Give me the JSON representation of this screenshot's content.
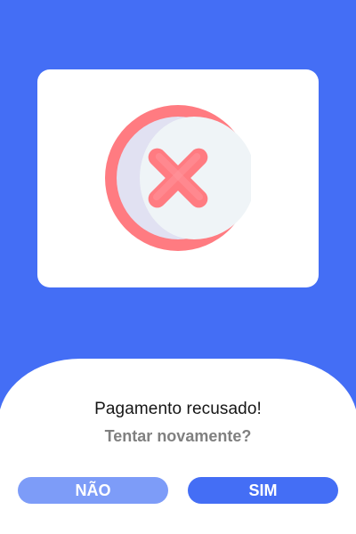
{
  "dialog": {
    "title": "Pagamento recusado!",
    "subtitle": "Tentar novamente?"
  },
  "buttons": {
    "no_label": "NÃO",
    "yes_label": "SIM"
  },
  "icon": {
    "name": "payment-declined-x-icon"
  },
  "colors": {
    "background": "#446ef5",
    "card": "#ffffff",
    "primary_button": "#446ef5",
    "secondary_button": "#7d9cf8",
    "icon_red": "#ff7b81",
    "subtitle_text": "#808080"
  }
}
